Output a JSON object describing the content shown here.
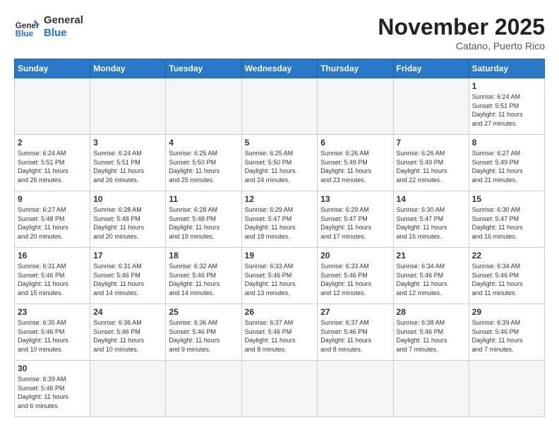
{
  "header": {
    "logo_general": "General",
    "logo_blue": "Blue",
    "month_title": "November 2025",
    "location": "Catano, Puerto Rico"
  },
  "weekdays": [
    "Sunday",
    "Monday",
    "Tuesday",
    "Wednesday",
    "Thursday",
    "Friday",
    "Saturday"
  ],
  "weeks": [
    [
      {
        "day": "",
        "info": ""
      },
      {
        "day": "",
        "info": ""
      },
      {
        "day": "",
        "info": ""
      },
      {
        "day": "",
        "info": ""
      },
      {
        "day": "",
        "info": ""
      },
      {
        "day": "",
        "info": ""
      },
      {
        "day": "1",
        "info": "Sunrise: 6:24 AM\nSunset: 5:51 PM\nDaylight: 11 hours\nand 27 minutes."
      }
    ],
    [
      {
        "day": "2",
        "info": "Sunrise: 6:24 AM\nSunset: 5:51 PM\nDaylight: 11 hours\nand 26 minutes."
      },
      {
        "day": "3",
        "info": "Sunrise: 6:24 AM\nSunset: 5:51 PM\nDaylight: 11 hours\nand 26 minutes."
      },
      {
        "day": "4",
        "info": "Sunrise: 6:25 AM\nSunset: 5:50 PM\nDaylight: 11 hours\nand 25 minutes."
      },
      {
        "day": "5",
        "info": "Sunrise: 6:25 AM\nSunset: 5:50 PM\nDaylight: 11 hours\nand 24 minutes."
      },
      {
        "day": "6",
        "info": "Sunrise: 6:26 AM\nSunset: 5:49 PM\nDaylight: 11 hours\nand 23 minutes."
      },
      {
        "day": "7",
        "info": "Sunrise: 6:26 AM\nSunset: 5:49 PM\nDaylight: 11 hours\nand 22 minutes."
      },
      {
        "day": "8",
        "info": "Sunrise: 6:27 AM\nSunset: 5:49 PM\nDaylight: 11 hours\nand 21 minutes."
      }
    ],
    [
      {
        "day": "9",
        "info": "Sunrise: 6:27 AM\nSunset: 5:48 PM\nDaylight: 11 hours\nand 20 minutes."
      },
      {
        "day": "10",
        "info": "Sunrise: 6:28 AM\nSunset: 5:48 PM\nDaylight: 11 hours\nand 20 minutes."
      },
      {
        "day": "11",
        "info": "Sunrise: 6:28 AM\nSunset: 5:48 PM\nDaylight: 11 hours\nand 19 minutes."
      },
      {
        "day": "12",
        "info": "Sunrise: 6:29 AM\nSunset: 5:47 PM\nDaylight: 11 hours\nand 18 minutes."
      },
      {
        "day": "13",
        "info": "Sunrise: 6:29 AM\nSunset: 5:47 PM\nDaylight: 11 hours\nand 17 minutes."
      },
      {
        "day": "14",
        "info": "Sunrise: 6:30 AM\nSunset: 5:47 PM\nDaylight: 11 hours\nand 16 minutes."
      },
      {
        "day": "15",
        "info": "Sunrise: 6:30 AM\nSunset: 5:47 PM\nDaylight: 11 hours\nand 16 minutes."
      }
    ],
    [
      {
        "day": "16",
        "info": "Sunrise: 6:31 AM\nSunset: 5:46 PM\nDaylight: 11 hours\nand 15 minutes."
      },
      {
        "day": "17",
        "info": "Sunrise: 6:31 AM\nSunset: 5:46 PM\nDaylight: 11 hours\nand 14 minutes."
      },
      {
        "day": "18",
        "info": "Sunrise: 6:32 AM\nSunset: 5:46 PM\nDaylight: 11 hours\nand 14 minutes."
      },
      {
        "day": "19",
        "info": "Sunrise: 6:33 AM\nSunset: 5:46 PM\nDaylight: 11 hours\nand 13 minutes."
      },
      {
        "day": "20",
        "info": "Sunrise: 6:33 AM\nSunset: 5:46 PM\nDaylight: 11 hours\nand 12 minutes."
      },
      {
        "day": "21",
        "info": "Sunrise: 6:34 AM\nSunset: 5:46 PM\nDaylight: 11 hours\nand 12 minutes."
      },
      {
        "day": "22",
        "info": "Sunrise: 6:34 AM\nSunset: 5:46 PM\nDaylight: 11 hours\nand 11 minutes."
      }
    ],
    [
      {
        "day": "23",
        "info": "Sunrise: 6:35 AM\nSunset: 5:46 PM\nDaylight: 11 hours\nand 10 minutes."
      },
      {
        "day": "24",
        "info": "Sunrise: 6:36 AM\nSunset: 5:46 PM\nDaylight: 11 hours\nand 10 minutes."
      },
      {
        "day": "25",
        "info": "Sunrise: 6:36 AM\nSunset: 5:46 PM\nDaylight: 11 hours\nand 9 minutes."
      },
      {
        "day": "26",
        "info": "Sunrise: 6:37 AM\nSunset: 5:46 PM\nDaylight: 11 hours\nand 8 minutes."
      },
      {
        "day": "27",
        "info": "Sunrise: 6:37 AM\nSunset: 5:46 PM\nDaylight: 11 hours\nand 8 minutes."
      },
      {
        "day": "28",
        "info": "Sunrise: 6:38 AM\nSunset: 5:46 PM\nDaylight: 11 hours\nand 7 minutes."
      },
      {
        "day": "29",
        "info": "Sunrise: 6:39 AM\nSunset: 5:46 PM\nDaylight: 11 hours\nand 7 minutes."
      }
    ],
    [
      {
        "day": "30",
        "info": "Sunrise: 6:39 AM\nSunset: 5:46 PM\nDaylight: 11 hours\nand 6 minutes."
      },
      {
        "day": "",
        "info": ""
      },
      {
        "day": "",
        "info": ""
      },
      {
        "day": "",
        "info": ""
      },
      {
        "day": "",
        "info": ""
      },
      {
        "day": "",
        "info": ""
      },
      {
        "day": "",
        "info": ""
      }
    ]
  ]
}
